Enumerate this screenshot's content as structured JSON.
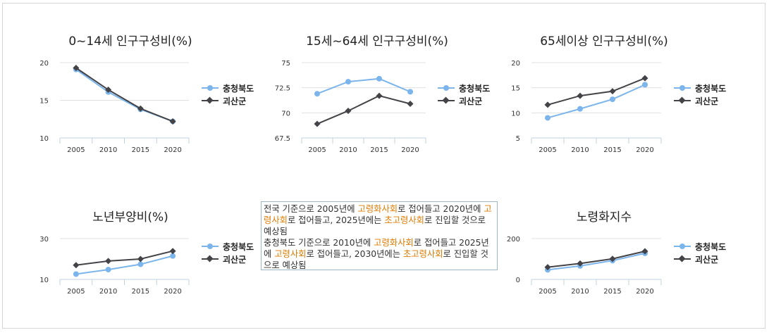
{
  "colors": {
    "series1": "#7cb5ec",
    "series2": "#434348",
    "grid": "#e0e0e0",
    "axis": "#c0d0e0",
    "highlight": "#e07a00"
  },
  "legend": {
    "series1": "충청북도",
    "series2": "괴산군"
  },
  "note": {
    "lines": [
      [
        {
          "t": "전국 기준으로 2005년에 "
        },
        {
          "t": "고령화사회",
          "hl": true
        },
        {
          "t": "로 접어들고 2020년에 "
        },
        {
          "t": "고령사회",
          "hl": true
        },
        {
          "t": "로 접어들고, 2025년에는 "
        },
        {
          "t": "초고령사회",
          "hl": true
        },
        {
          "t": "로 진입할 것으로 예상됨"
        }
      ],
      [
        {
          "t": "충청북도 기준으로 2010년에 "
        },
        {
          "t": "고령화사회",
          "hl": true
        },
        {
          "t": "로 접어들고 2025년에 "
        },
        {
          "t": "고령사회",
          "hl": true
        },
        {
          "t": "로 접어들고, 2030년에는 "
        },
        {
          "t": "초고령사회",
          "hl": true
        },
        {
          "t": "로 진입할 것으로 예상됨"
        }
      ]
    ]
  },
  "chart_data": [
    {
      "id": "c1",
      "type": "line",
      "title": "0~14세 인구구성비(%)",
      "categories": [
        "2005",
        "2010",
        "2015",
        "2020"
      ],
      "ylim": [
        10,
        20
      ],
      "yticks": [
        "10",
        "15",
        "20"
      ],
      "series": [
        {
          "name": "충청북도",
          "values": [
            19.1,
            16.1,
            13.8,
            12.2
          ]
        },
        {
          "name": "괴산군",
          "values": [
            19.3,
            16.4,
            13.9,
            12.2
          ]
        }
      ]
    },
    {
      "id": "c2",
      "type": "line",
      "title": "15세~64세 인구구성비(%)",
      "categories": [
        "2005",
        "2010",
        "2015",
        "2020"
      ],
      "ylim": [
        67.5,
        75
      ],
      "yticks": [
        "67.5",
        "70",
        "72.5",
        "75"
      ],
      "series": [
        {
          "name": "충청북도",
          "values": [
            71.9,
            73.1,
            73.4,
            72.1
          ]
        },
        {
          "name": "괴산군",
          "values": [
            68.9,
            70.2,
            71.7,
            70.9
          ]
        }
      ]
    },
    {
      "id": "c3",
      "type": "line",
      "title": "65세이상 인구구성비(%)",
      "categories": [
        "2005",
        "2010",
        "2015",
        "2020"
      ],
      "ylim": [
        5,
        20
      ],
      "yticks": [
        "5",
        "10",
        "15",
        "20"
      ],
      "series": [
        {
          "name": "충청북도",
          "values": [
            9.0,
            10.8,
            12.7,
            15.6
          ]
        },
        {
          "name": "괴산군",
          "values": [
            11.6,
            13.4,
            14.3,
            16.9
          ]
        }
      ]
    },
    {
      "id": "c4",
      "type": "line",
      "title": "노년부양비(%)",
      "categories": [
        "2005",
        "2010",
        "2015",
        "2020"
      ],
      "ylim": [
        10,
        30
      ],
      "yticks": [
        "10",
        "30"
      ],
      "series": [
        {
          "name": "충청북도",
          "values": [
            12.6,
            14.8,
            17.4,
            21.5
          ]
        },
        {
          "name": "괴산군",
          "values": [
            17.0,
            19.0,
            20.0,
            23.9
          ]
        }
      ]
    },
    {
      "id": "c5",
      "type": "line",
      "title": "노령화지수",
      "categories": [
        "2005",
        "2010",
        "2015",
        "2020"
      ],
      "ylim": [
        0,
        200
      ],
      "yticks": [
        "0",
        "200"
      ],
      "series": [
        {
          "name": "충청북도",
          "values": [
            47,
            66,
            92,
            128
          ]
        },
        {
          "name": "괴산군",
          "values": [
            60,
            78,
            101,
            138
          ]
        }
      ]
    }
  ]
}
